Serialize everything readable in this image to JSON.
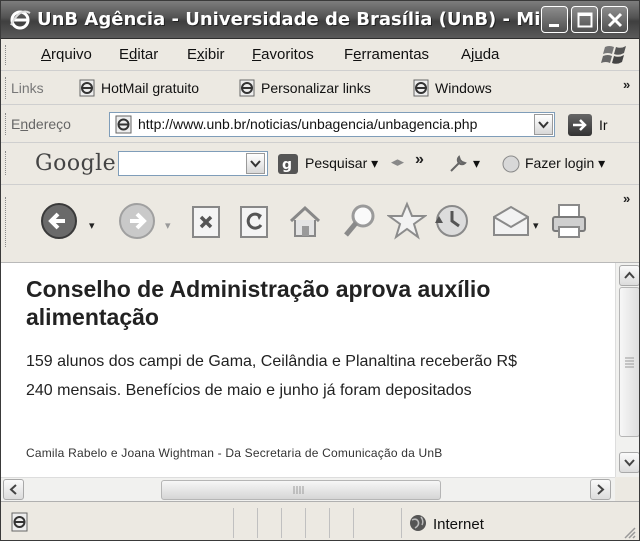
{
  "window": {
    "title": "UnB Agência - Universidade de Brasília (UnB) - Mi..."
  },
  "menubar": {
    "items": [
      {
        "pre": "",
        "acc": "A",
        "post": "rquivo"
      },
      {
        "pre": "E",
        "acc": "d",
        "post": "itar"
      },
      {
        "pre": "E",
        "acc": "x",
        "post": "ibir"
      },
      {
        "pre": "",
        "acc": "F",
        "post": "avoritos"
      },
      {
        "pre": "F",
        "acc": "e",
        "post": "rramentas"
      },
      {
        "pre": "Aj",
        "acc": "u",
        "post": "da"
      }
    ]
  },
  "links": {
    "label": "Links",
    "items": [
      "HotMail gratuito",
      "Personalizar links",
      "Windows"
    ]
  },
  "address": {
    "label_pre": "E",
    "label_acc": "n",
    "label_post": "dereço",
    "url": "http://www.unb.br/noticias/unbagencia/unbagencia.php",
    "go_label": "Ir"
  },
  "google": {
    "logo": "Google",
    "search_value": "",
    "search_label": "Pesquisar",
    "login_label": "Fazer login"
  },
  "article": {
    "headline": "Conselho de Administração aprova auxílio alimentação",
    "lead_line1": "159 alunos dos campi de Gama, Ceilândia e Planaltina receberão R$",
    "lead_line2": "240 mensais. Benefícios de maio e junho  já foram depositados",
    "byline": "Camila Rabelo e Joana Wightman - Da Secretaria de Comunicação da UnB"
  },
  "status": {
    "zone": "Internet"
  },
  "icons": [
    "ie-icon",
    "minimize-icon",
    "maximize-icon",
    "close-icon",
    "windows-logo-icon",
    "back-icon",
    "forward-icon",
    "stop-icon",
    "refresh-icon",
    "home-icon",
    "search-icon",
    "favorites-icon",
    "history-icon",
    "mail-icon",
    "print-icon",
    "globe-icon"
  ]
}
